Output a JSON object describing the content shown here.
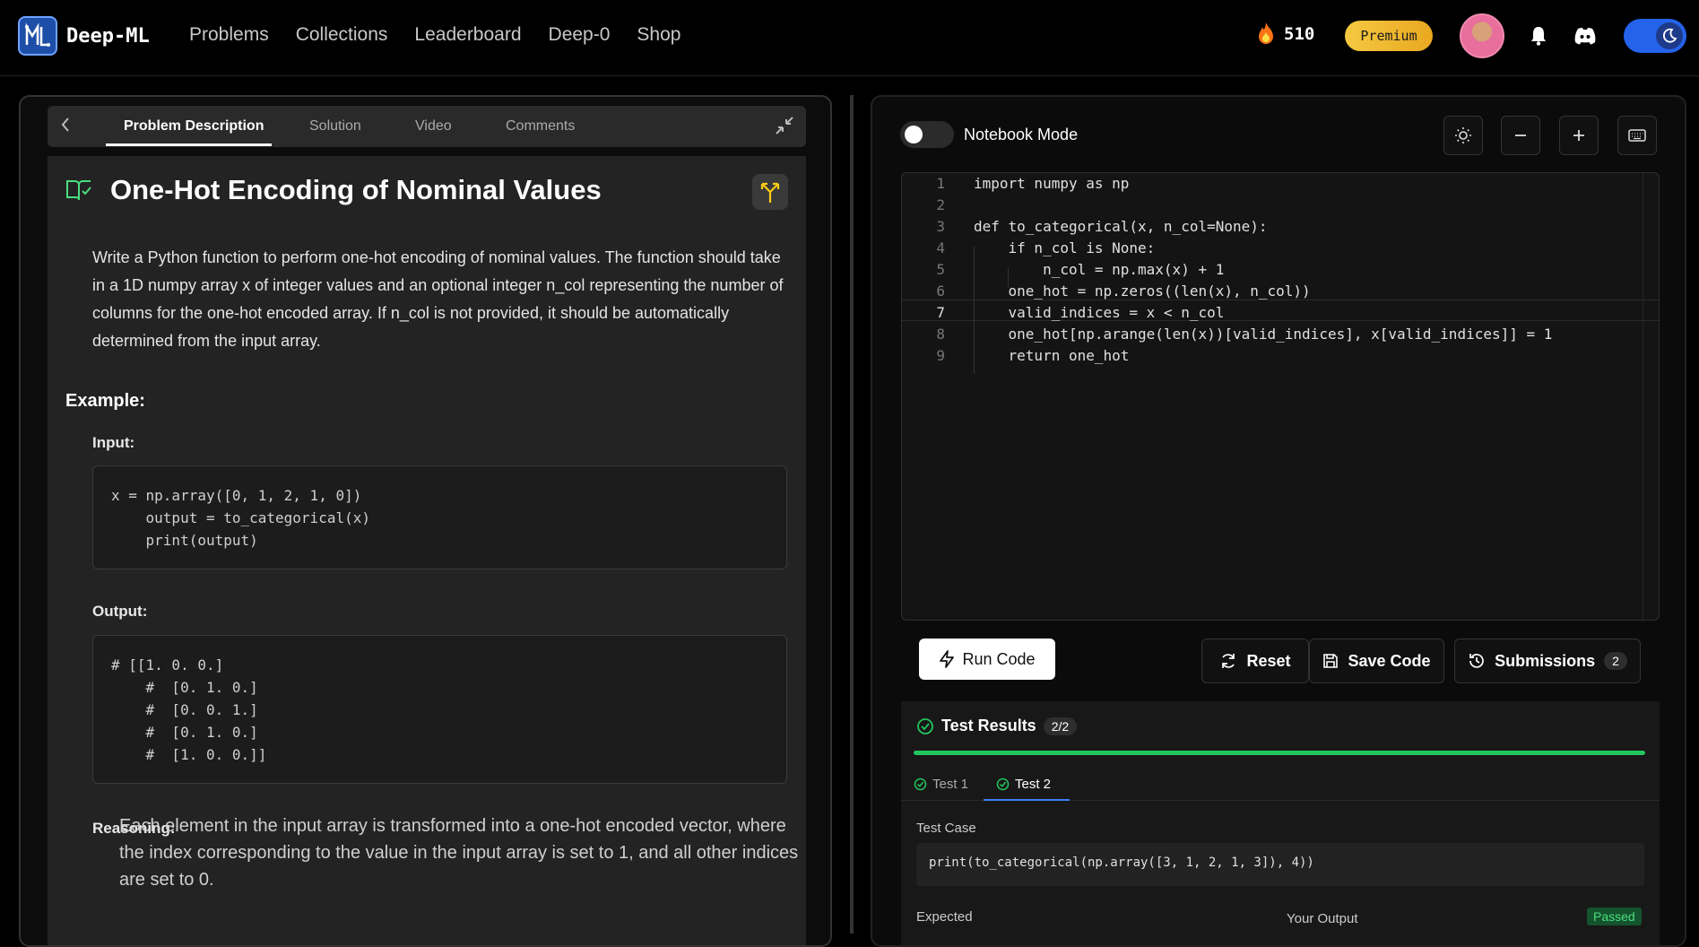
{
  "brand": {
    "name": "Deep-ML",
    "logo_letters": "ML"
  },
  "nav": [
    "Problems",
    "Collections",
    "Leaderboard",
    "Deep-0",
    "Shop"
  ],
  "user": {
    "streak": "510",
    "plan": "Premium"
  },
  "tabs": {
    "items": [
      "Problem Description",
      "Solution",
      "Video",
      "Comments"
    ],
    "active": "Problem Description"
  },
  "problem": {
    "title": "One-Hot Encoding of Nominal Values",
    "description": "Write a Python function to perform one-hot encoding of nominal values. The function should take in a 1D numpy array x of integer values and an optional integer n_col representing the number of columns for the one-hot encoded array. If n_col is not provided, it should be automatically determined from the input array.",
    "example_heading": "Example:",
    "input_heading": "Input:",
    "input_code": "x = np.array([0, 1, 2, 1, 0])\n    output = to_categorical(x)\n    print(output)",
    "output_heading": "Output:",
    "output_code": "# [[1. 0. 0.]\n    #  [0. 1. 0.]\n    #  [0. 0. 1.]\n    #  [0. 1. 0.]\n    #  [1. 0. 0.]]",
    "reasoning_heading": "Reasoning:",
    "reasoning": "Each element in the input array is transformed into a one-hot encoded vector, where the index corresponding to the value in the input array is set to 1, and all other indices are set to 0."
  },
  "editor": {
    "notebook_label": "Notebook Mode",
    "line_numbers": [
      "1",
      "2",
      "3",
      "4",
      "5",
      "6",
      "7",
      "8",
      "9"
    ],
    "lines": [
      "import numpy as np",
      "",
      "def to_categorical(x, n_col=None):",
      "    if n_col is None:",
      "        n_col = np.max(x) + 1",
      "    one_hot = np.zeros((len(x), n_col))",
      "    valid_indices = x < n_col",
      "    one_hot[np.arange(len(x))[valid_indices], x[valid_indices]] = 1",
      "    return one_hot"
    ]
  },
  "actions": {
    "run": "Run Code",
    "reset": "Reset",
    "save": "Save Code",
    "submissions": "Submissions",
    "submissions_count": "2"
  },
  "results": {
    "title": "Test Results",
    "score": "2/2",
    "tests": [
      "Test 1",
      "Test 2"
    ],
    "active_test": "Test 2",
    "test_case_label": "Test Case",
    "test_case": "print(to_categorical(np.array([3, 1, 2, 1, 3]), 4))",
    "expected_label": "Expected",
    "output_label": "Your Output",
    "status": "Passed"
  },
  "colors": {
    "accent": "#22c55e",
    "premium": "#f5c842",
    "toggle": "#2563eb"
  }
}
